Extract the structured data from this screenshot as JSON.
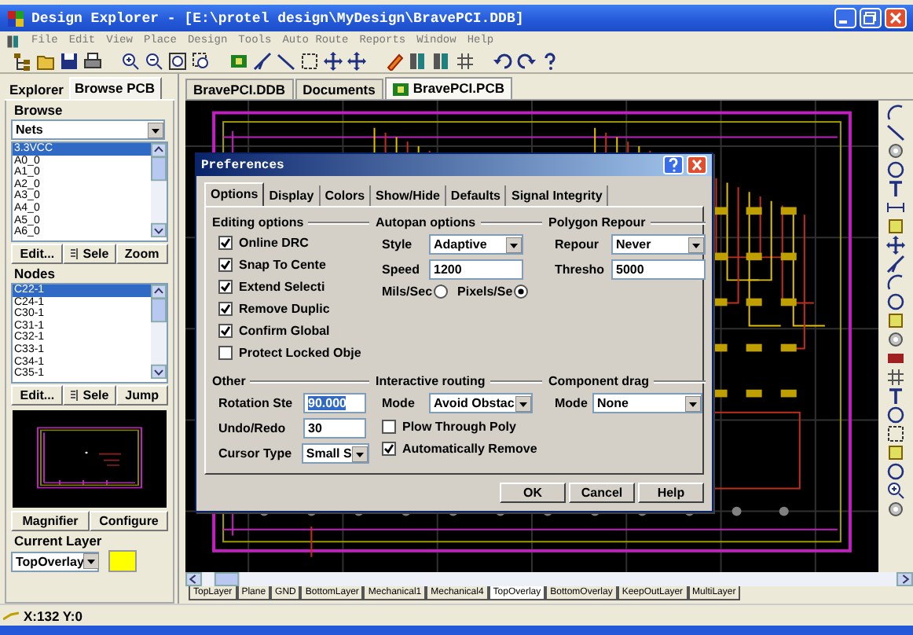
{
  "window": {
    "title": "Design Explorer - [E:\\protel design\\MyDesign\\BravePCI.DDB]"
  },
  "menu": [
    "File",
    "Edit",
    "View",
    "Place",
    "Design",
    "Tools",
    "Auto Route",
    "Reports",
    "Window",
    "Help"
  ],
  "panel": {
    "tabs": [
      {
        "label": "Explorer",
        "selected": false
      },
      {
        "label": "Browse PCB",
        "selected": true
      }
    ],
    "browse": {
      "title": "Browse",
      "filter": "Nets",
      "items": [
        {
          "label": "3.3VCC",
          "selected": true
        },
        {
          "label": "A0_0",
          "selected": false
        },
        {
          "label": "A1_0",
          "selected": false
        },
        {
          "label": "A2_0",
          "selected": false
        },
        {
          "label": "A3_0",
          "selected": false
        },
        {
          "label": "A4_0",
          "selected": false
        },
        {
          "label": "A5_0",
          "selected": false
        },
        {
          "label": "A6_0",
          "selected": false
        }
      ],
      "buttons": [
        "Edit...",
        "Sele",
        "Zoom"
      ]
    },
    "nodes": {
      "title": "Nodes",
      "items": [
        {
          "label": "C22-1",
          "selected": true
        },
        {
          "label": "C24-1",
          "selected": false
        },
        {
          "label": "C30-1",
          "selected": false
        },
        {
          "label": "C31-1",
          "selected": false
        },
        {
          "label": "C32-1",
          "selected": false
        },
        {
          "label": "C33-1",
          "selected": false
        },
        {
          "label": "C34-1",
          "selected": false
        },
        {
          "label": "C35-1",
          "selected": false
        }
      ],
      "buttons": [
        "Edit...",
        "Sele",
        "Jump"
      ]
    },
    "preview_buttons": [
      "Magnifier",
      "Configure"
    ],
    "current_layer": {
      "title": "Current Layer",
      "value": "TopOverlay",
      "color": "#ffff00"
    }
  },
  "documents": {
    "tabs": [
      {
        "label": "BravePCI.DDB",
        "selected": false
      },
      {
        "label": "Documents",
        "selected": false
      },
      {
        "label": "BravePCI.PCB",
        "selected": true
      }
    ]
  },
  "layer_tabs": [
    {
      "label": "TopLayer",
      "selected": false
    },
    {
      "label": "Plane",
      "selected": false
    },
    {
      "label": "GND",
      "selected": false
    },
    {
      "label": "BottomLayer",
      "selected": false
    },
    {
      "label": "Mechanical1",
      "selected": false
    },
    {
      "label": "Mechanical4",
      "selected": false
    },
    {
      "label": "TopOverlay",
      "selected": true
    },
    {
      "label": "BottomOverlay",
      "selected": false
    },
    {
      "label": "KeepOutLayer",
      "selected": false
    },
    {
      "label": "MultiLayer",
      "selected": false
    }
  ],
  "status_bar": {
    "coords": "X:132 Y:0"
  },
  "dialog": {
    "title": "Preferences",
    "tabs": [
      {
        "label": "Options",
        "selected": true
      },
      {
        "label": "Display",
        "selected": false
      },
      {
        "label": "Colors",
        "selected": false
      },
      {
        "label": "Show/Hide",
        "selected": false
      },
      {
        "label": "Defaults",
        "selected": false
      },
      {
        "label": "Signal Integrity",
        "selected": false
      }
    ],
    "editing": {
      "title": "Editing options",
      "options": [
        {
          "label": "Online DRC",
          "checked": true
        },
        {
          "label": "Snap To Cente",
          "checked": true
        },
        {
          "label": "Extend Selecti",
          "checked": true
        },
        {
          "label": "Remove Duplic",
          "checked": true
        },
        {
          "label": "Confirm Global",
          "checked": true
        },
        {
          "label": "Protect Locked Obje",
          "checked": false
        }
      ]
    },
    "autopan": {
      "title": "Autopan options",
      "style_label": "Style",
      "style": "Adaptive",
      "speed_label": "Speed",
      "speed": "1200",
      "units": [
        {
          "label": "Mils/Sec",
          "selected": false
        },
        {
          "label": "Pixels/Se",
          "selected": true
        }
      ]
    },
    "polygon": {
      "title": "Polygon Repour",
      "repour_label": "Repour",
      "repour": "Never",
      "threshold_label": "Thresho",
      "threshold": "5000"
    },
    "other": {
      "title": "Other",
      "rotation_label": "Rotation Ste",
      "rotation": "90.000",
      "undo_label": "Undo/Redo",
      "undo": "30",
      "cursor_label": "Cursor Type",
      "cursor": "Small S"
    },
    "routing": {
      "title": "Interactive routing",
      "mode_label": "Mode",
      "mode": "Avoid Obstac",
      "options": [
        {
          "label": "Plow Through Poly",
          "checked": false
        },
        {
          "label": "Automatically Remove",
          "checked": true
        }
      ]
    },
    "drag": {
      "title": "Component drag",
      "mode_label": "Mode",
      "mode": "None"
    },
    "buttons": [
      "OK",
      "Cancel",
      "Help"
    ]
  }
}
